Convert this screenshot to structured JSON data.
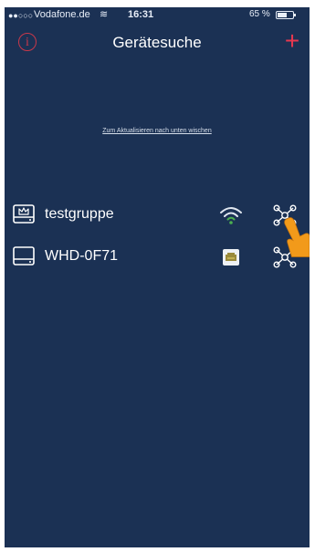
{
  "status_bar": {
    "signal": "●●○○○",
    "carrier": "Vodafone.de",
    "wifi_glyph": "≋",
    "time": "16:31",
    "battery_percent": "65 %",
    "battery_level": 0.65
  },
  "nav": {
    "info_glyph": "i",
    "title": "Gerätesuche",
    "add_glyph": "+"
  },
  "refresh_hint": "Zum Aktualisieren nach unten wischen",
  "devices": [
    {
      "name": "testgruppe",
      "device_icon": "group-disk-icon",
      "connection_icon": "wifi-icon",
      "action_icon": "network-icon"
    },
    {
      "name": "WHD-0F71",
      "device_icon": "disk-icon",
      "connection_icon": "ethernet-icon",
      "action_icon": "network-icon"
    }
  ],
  "colors": {
    "background": "#1b3154",
    "accent_red": "#e8384f",
    "wifi_green": "#4caf50",
    "text": "#ffffff"
  }
}
